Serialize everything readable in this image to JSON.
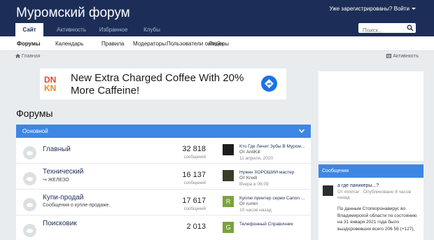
{
  "site": {
    "title": "Муромский форум",
    "signin_label": "Уже зарегистрированы? Войти"
  },
  "nav": {
    "tabs": [
      {
        "label": "Сайт",
        "active": true
      },
      {
        "label": "Активность"
      },
      {
        "label": "Избранное"
      },
      {
        "label": "Клубы"
      }
    ]
  },
  "search": {
    "placeholder": "Поиск..."
  },
  "subnav": {
    "items": [
      {
        "label": "Форумы",
        "active": true
      },
      {
        "label": "Календарь"
      },
      {
        "label": "Правила"
      },
      {
        "label": "Модераторы"
      },
      {
        "label": "Пользователи онлайн"
      },
      {
        "label": "Лидеры"
      }
    ]
  },
  "breadcrumb": {
    "home_label": "Главная"
  },
  "activity_link": {
    "label": "Активность"
  },
  "ad": {
    "logo_text": [
      "DN",
      "KN"
    ],
    "text": "New Extra Charged Coffee With 20% More Caffeine!"
  },
  "page_title": "Форумы",
  "category": {
    "title": "Основной"
  },
  "forums": [
    {
      "name": "Главный",
      "description": "",
      "count": "32 818",
      "count_label": "сообщений",
      "last": {
        "title": "Кто Где Лечит Зубы В Муром...",
        "by": "От AntiKill",
        "date": "11 апреля, 2020",
        "avatar_color": "#1d1d1d",
        "avatar_letter": ""
      }
    },
    {
      "name": "Технический",
      "description": "ЖЕЛЕЗО",
      "count": "16 137",
      "count_label": "сообщений",
      "last": {
        "title": "Нужен ХОРОШИЙ мастер",
        "by": "От Kredl",
        "date": "Вчера в 06:09",
        "avatar_color": "#3b3b26",
        "avatar_letter": ""
      }
    },
    {
      "name": "Купи-продай",
      "description": "Сообщения о купле-продаже.",
      "count": "17 617",
      "count_label": "сообщений",
      "last": {
        "title": "Куплю принтер серии Canon ...",
        "by": "От rumin",
        "date": "10 часов назад",
        "avatar_color": "#7aa33b",
        "avatar_letter": "R"
      }
    },
    {
      "name": "Поисковик",
      "description": "",
      "count": "2 013",
      "count_label": "",
      "last": {
        "title": "Телефонный Справочник",
        "by": "",
        "date": "",
        "avatar_color": "#7aa33b",
        "avatar_letter": "G"
      }
    }
  ],
  "messages": {
    "header": "Сообщения",
    "item": {
      "title": "а где паникеры...?",
      "meta": "От mixmar · Опубликовано 8 часов назад",
      "text": "По данным Стопкоронавирус во Владимирской области по состоянию на 31 января 2021 года было выздоровевших всего 206 56 (+127),"
    }
  },
  "colors": {
    "header_bg": "#1c2e57",
    "accent": "#3e86e4",
    "page_bg": "#e9ecee",
    "ad_button": "#1a73e8",
    "ad_logo_red": "#e8452c"
  }
}
